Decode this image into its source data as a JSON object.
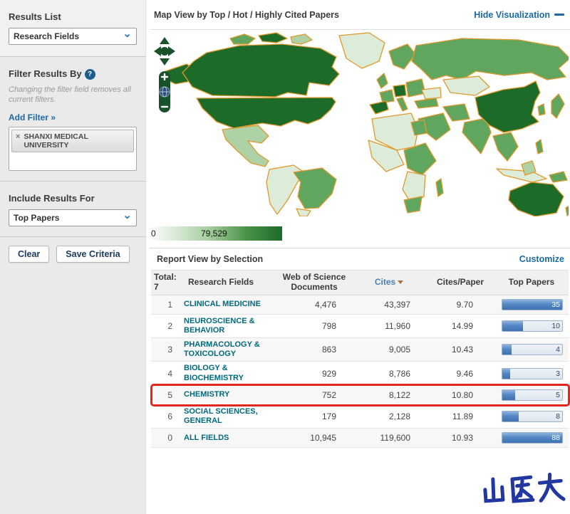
{
  "sidebar": {
    "results_list": {
      "label": "Results List",
      "selected": "Research Fields"
    },
    "filter": {
      "heading": "Filter Results By",
      "help_icon": "?",
      "note": "Changing the filter field removes all current filters.",
      "add_filter": "Add Filter »",
      "chip": {
        "remove": "×",
        "label": "SHANXI MEDICAL UNIVERSITY"
      }
    },
    "include": {
      "label": "Include Results For",
      "selected": "Top Papers"
    },
    "buttons": {
      "clear": "Clear",
      "save": "Save Criteria"
    }
  },
  "map": {
    "title": "Map View by Top / Hot / Highly Cited Papers",
    "hide_link": "Hide Visualization",
    "legend": {
      "min": "0",
      "max": "79,529"
    },
    "palette": {
      "none": "#ffffff",
      "low": "#dcecd8",
      "mid_low": "#aed2a6",
      "mid": "#61a65e",
      "high": "#1d6b28",
      "border": "#e0992c"
    }
  },
  "report": {
    "title": "Report View by Selection",
    "customize": "Customize",
    "highlight_color": "#e3261d",
    "table": {
      "total_label": "Total:",
      "total_value": "7",
      "columns": {
        "field": "Research Fields",
        "documents": "Web of Science Documents",
        "cites": "Cites",
        "cites_per_paper": "Cites/Paper",
        "top_papers": "Top Papers"
      },
      "sort_column": "Cites",
      "rows": [
        {
          "rank": "1",
          "field": "CLINICAL MEDICINE",
          "documents": "4,476",
          "cites": "43,397",
          "cites_per_paper": "9.70",
          "top_papers": "35",
          "bar_pct": 100,
          "highlight": false
        },
        {
          "rank": "2",
          "field": "NEUROSCIENCE & BEHAVIOR",
          "documents": "798",
          "cites": "11,960",
          "cites_per_paper": "14.99",
          "top_papers": "10",
          "bar_pct": 35,
          "highlight": false
        },
        {
          "rank": "3",
          "field": "PHARMACOLOGY & TOXICOLOGY",
          "documents": "863",
          "cites": "9,005",
          "cites_per_paper": "10.43",
          "top_papers": "4",
          "bar_pct": 16,
          "highlight": false
        },
        {
          "rank": "4",
          "field": "BIOLOGY & BIOCHEMISTRY",
          "documents": "929",
          "cites": "8,786",
          "cites_per_paper": "9.46",
          "top_papers": "3",
          "bar_pct": 13,
          "highlight": false
        },
        {
          "rank": "5",
          "field": "CHEMISTRY",
          "documents": "752",
          "cites": "8,122",
          "cites_per_paper": "10.80",
          "top_papers": "5",
          "bar_pct": 21,
          "highlight": true
        },
        {
          "rank": "6",
          "field": "SOCIAL SCIENCES, GENERAL",
          "documents": "179",
          "cites": "2,128",
          "cites_per_paper": "11.89",
          "top_papers": "8",
          "bar_pct": 27,
          "highlight": false
        },
        {
          "rank": "0",
          "field": "ALL FIELDS",
          "documents": "10,945",
          "cites": "119,600",
          "cites_per_paper": "10.93",
          "top_papers": "88",
          "bar_pct": 100,
          "highlight": false
        }
      ]
    }
  },
  "watermark": {
    "text": "山医大",
    "color": "#2238a0"
  }
}
